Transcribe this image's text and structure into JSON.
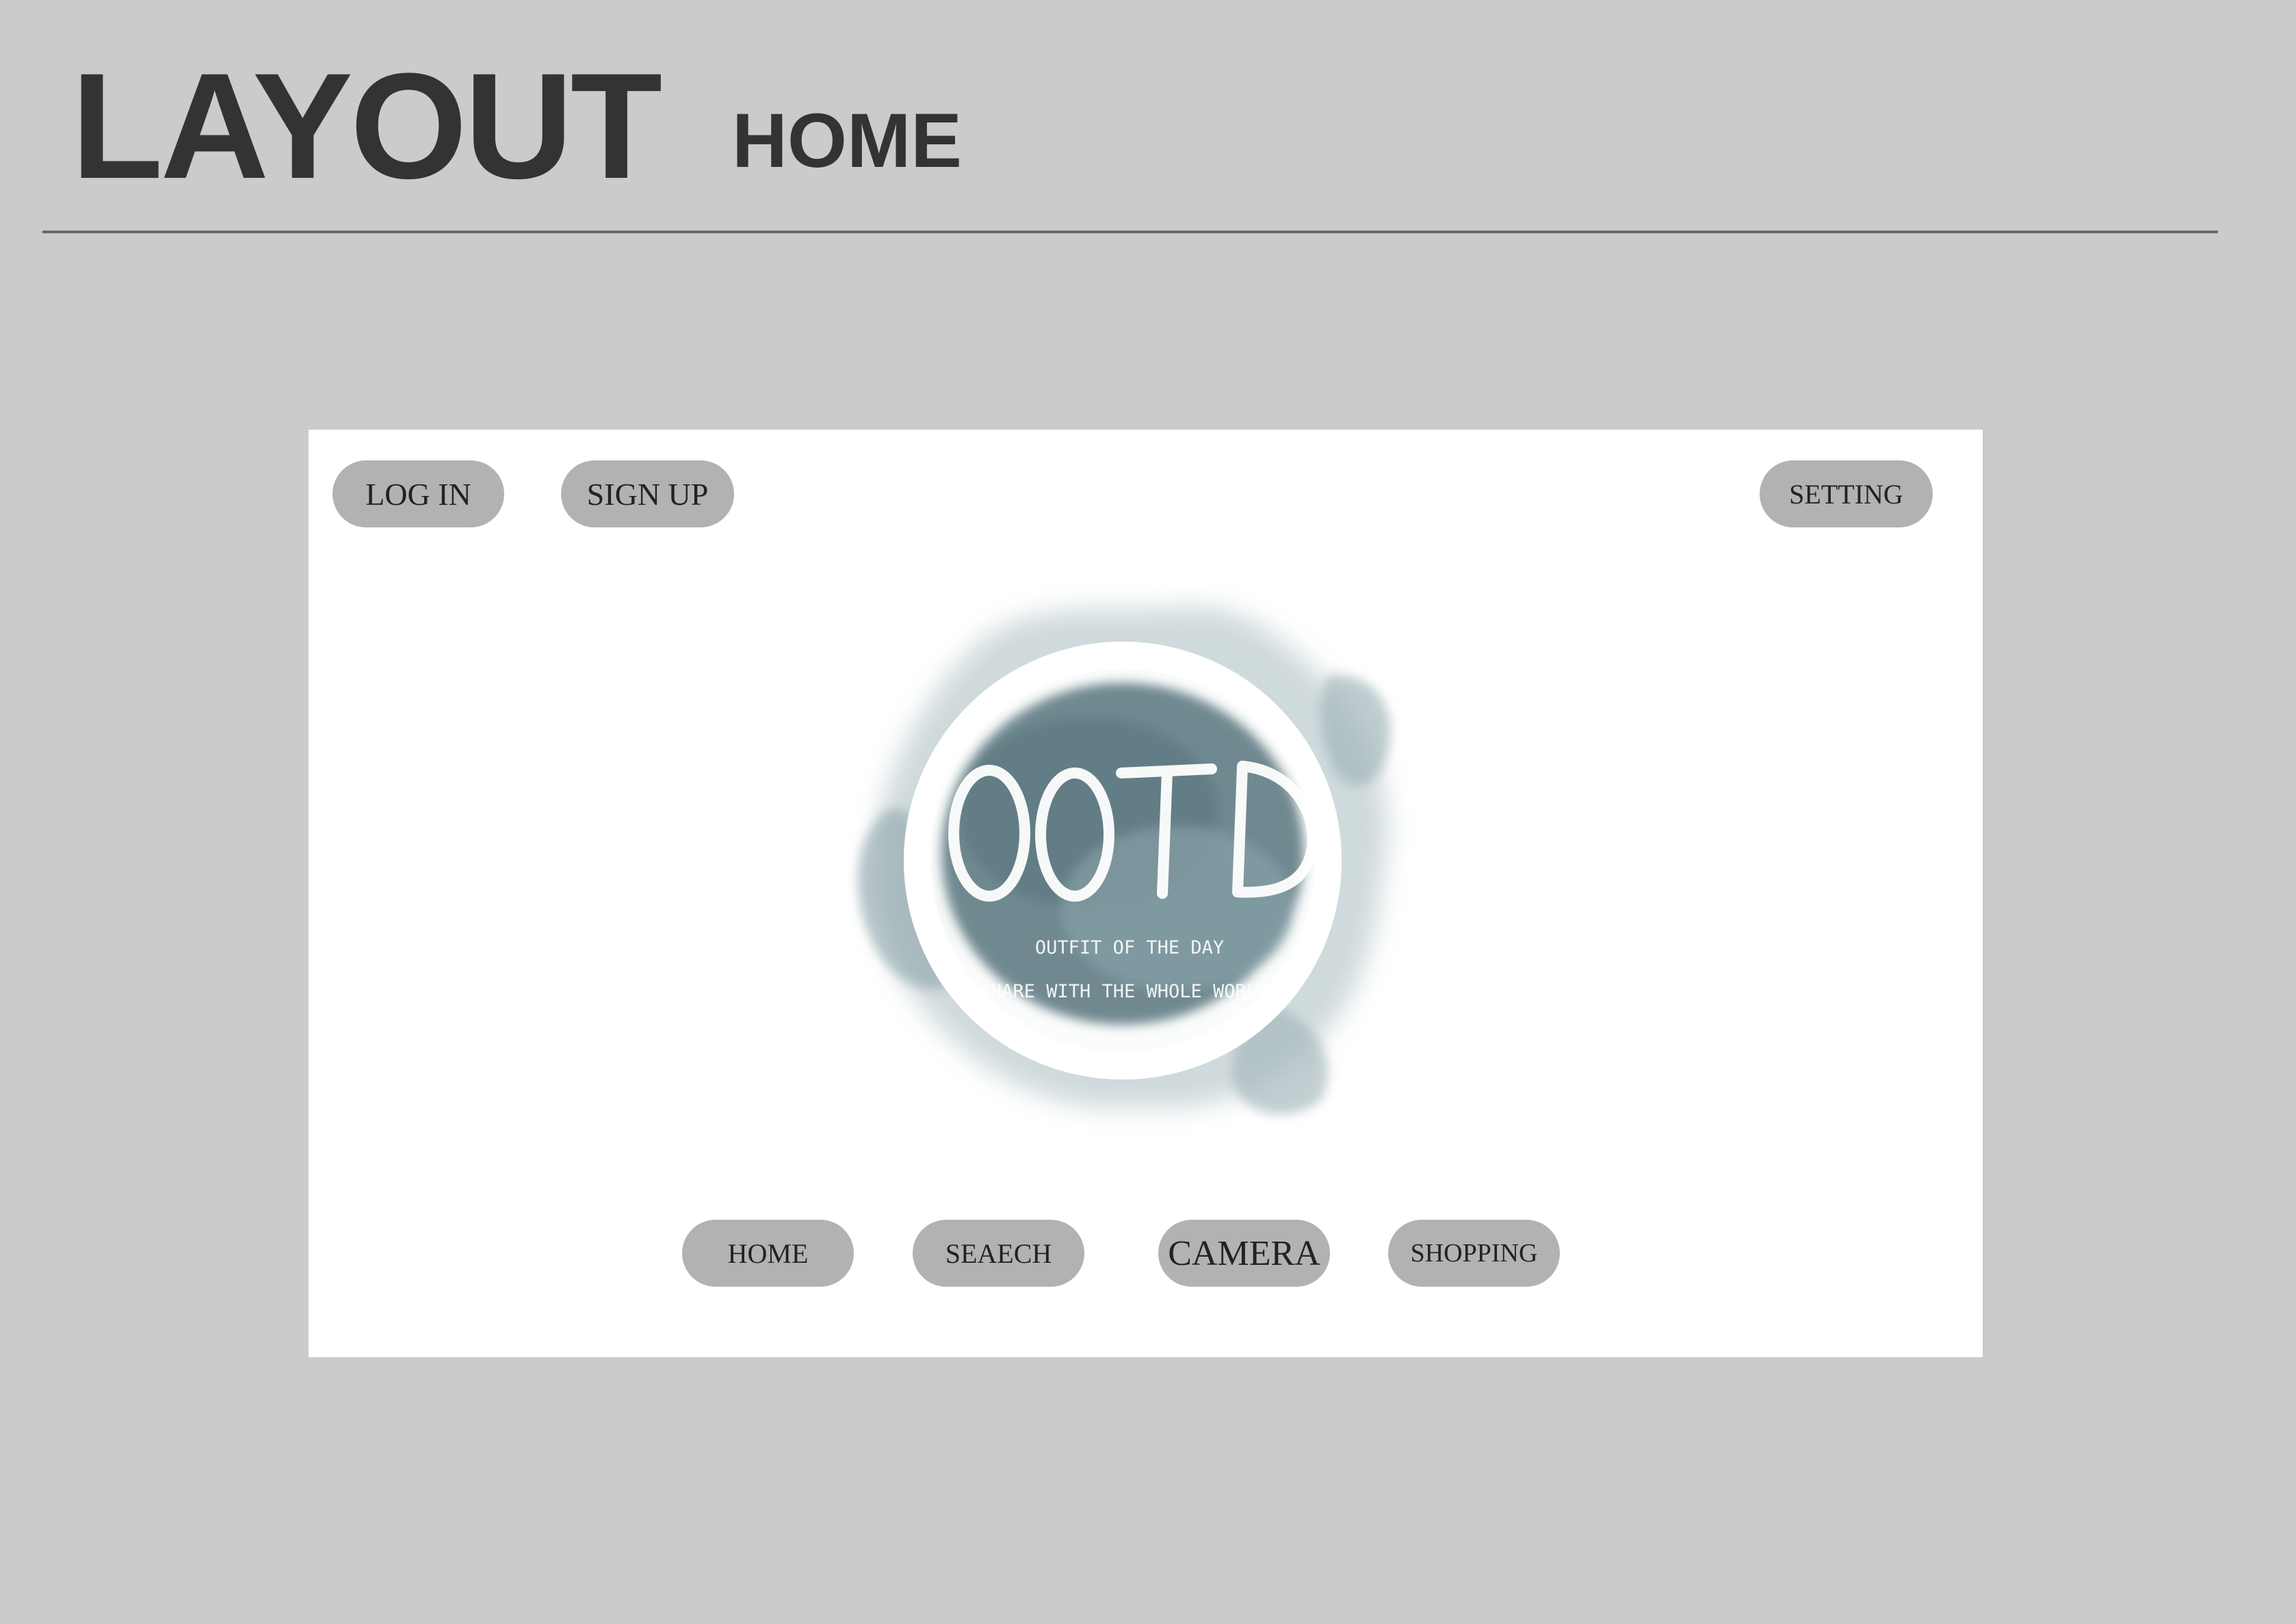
{
  "header": {
    "title": "LAYOUT",
    "subtitle": "HOME"
  },
  "top_bar": {
    "login_label": "LOG IN",
    "signup_label": "SIGN UP",
    "setting_label": "SETTING"
  },
  "logo": {
    "wordmark": "OOTD",
    "tagline_1": "OUTFIT OF THE DAY",
    "tagline_2": "SHARE WITH THE WHOLE WORLD"
  },
  "bottom_nav": {
    "items": [
      {
        "label": "HOME",
        "icon": "none"
      },
      {
        "label": "SEAECH",
        "icon": "none"
      },
      {
        "label": "CAMERA",
        "icon": "none"
      },
      {
        "label": "SHOPPING",
        "icon": "none"
      }
    ]
  },
  "colors": {
    "page_background": "#cbcbcb",
    "screen_background": "#ffffff",
    "button_fill": "#b2b2b2",
    "heading_text": "#333333",
    "logo_ink": "#7f969c"
  }
}
